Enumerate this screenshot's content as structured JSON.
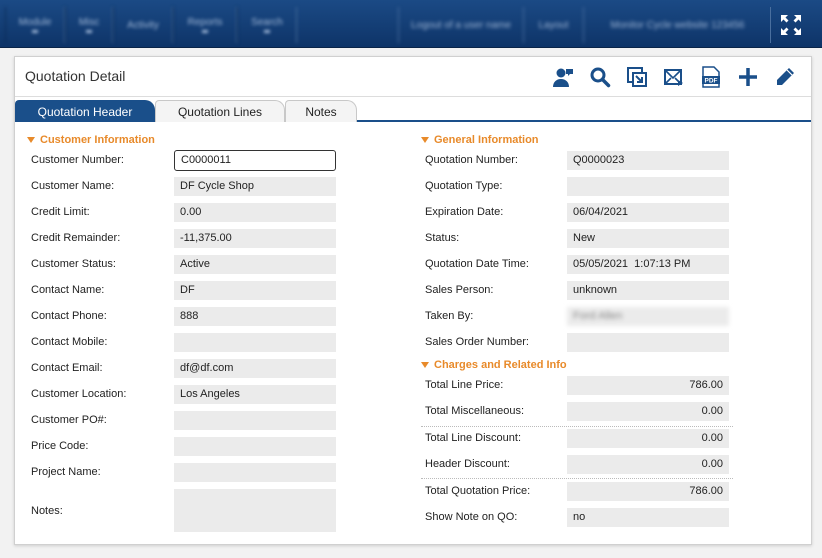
{
  "topbar": {
    "nav": [
      "Module",
      "Misc",
      "Activity",
      "Reports",
      "Search"
    ],
    "right": [
      "Logout of a user name",
      "Layout",
      "Monitor Cycle website 123456"
    ],
    "expand_icon": "fullscreen-icon"
  },
  "panel": {
    "title": "Quotation Detail",
    "toolbar_icons": [
      "contact-icon",
      "search-icon",
      "copy-window-icon",
      "email-icon",
      "pdf-icon",
      "add-icon",
      "edit-icon"
    ],
    "pdf_label": "PDF"
  },
  "tabs": [
    {
      "label": "Quotation Header",
      "active": true
    },
    {
      "label": "Quotation Lines",
      "active": false
    },
    {
      "label": "Notes",
      "active": false
    }
  ],
  "customer": {
    "title": "Customer Information",
    "fields": [
      {
        "label": "Customer Number:",
        "value": "C0000011"
      },
      {
        "label": "Customer Name:",
        "value": "DF Cycle Shop"
      },
      {
        "label": "Credit Limit:",
        "value": "0.00"
      },
      {
        "label": "Credit Remainder:",
        "value": "-11,375.00"
      },
      {
        "label": "Customer Status:",
        "value": "Active"
      },
      {
        "label": "Contact Name:",
        "value": "DF"
      },
      {
        "label": "Contact Phone:",
        "value": "888"
      },
      {
        "label": "Contact Mobile:",
        "value": ""
      },
      {
        "label": "Contact Email:",
        "value": "df@df.com"
      },
      {
        "label": "Customer Location:",
        "value": "Los Angeles"
      },
      {
        "label": "Customer PO#:",
        "value": ""
      },
      {
        "label": "Price Code:",
        "value": ""
      },
      {
        "label": "Project Name:",
        "value": ""
      },
      {
        "label": "Notes:",
        "value": ""
      }
    ]
  },
  "general": {
    "title": "General Information",
    "fields": [
      {
        "label": "Quotation Number:",
        "value": "Q0000023"
      },
      {
        "label": "Quotation Type:",
        "value": ""
      },
      {
        "label": "Expiration Date:",
        "value": "06/04/2021"
      },
      {
        "label": "Status:",
        "value": "New"
      },
      {
        "label": "Quotation Date Time:",
        "value": "05/05/2021  1:07:13 PM"
      },
      {
        "label": "Sales Person:",
        "value": "unknown"
      },
      {
        "label": "Taken By:",
        "value": "Ford Allen"
      },
      {
        "label": "Sales Order Number:",
        "value": ""
      }
    ]
  },
  "charges": {
    "title": "Charges and Related Info",
    "fields": [
      {
        "label": "Total Line Price:",
        "value": "786.00"
      },
      {
        "label": "Total Miscellaneous:",
        "value": "0.00"
      },
      {
        "label": "Total Line Discount:",
        "value": "0.00"
      },
      {
        "label": "Header Discount:",
        "value": "0.00"
      },
      {
        "label": "Total Quotation Price:",
        "value": "786.00"
      },
      {
        "label": "Show Note on QO:",
        "value": "no"
      }
    ]
  },
  "colors": {
    "accent": "#1a4f8a",
    "section": "#e88a2a",
    "field_bg": "#ebebeb"
  }
}
